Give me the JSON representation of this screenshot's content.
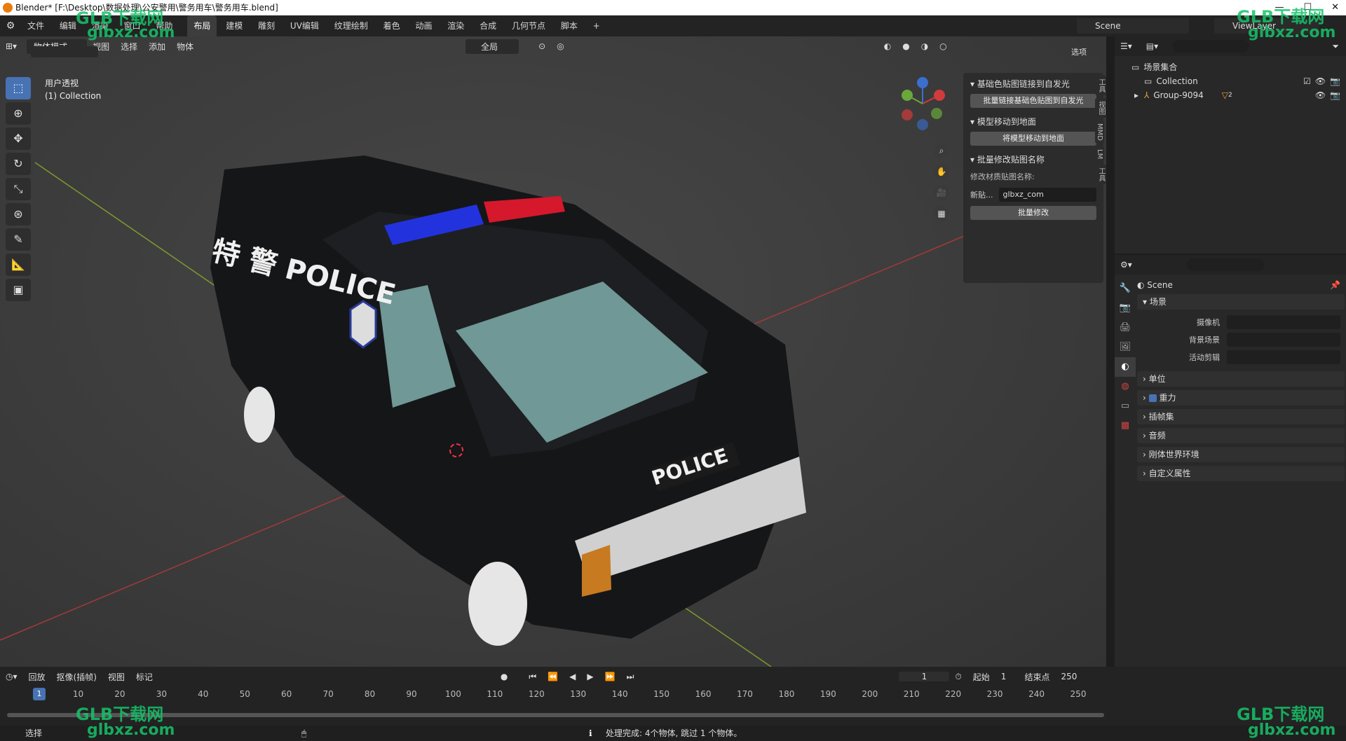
{
  "title": "Blender* [F:\\Desktop\\数据处理\\公安警用\\警务用车\\警务用车.blend]",
  "menu": [
    "文件",
    "编辑",
    "渲染",
    "窗口",
    "帮助"
  ],
  "workspaces": [
    "布局",
    "建模",
    "雕刻",
    "UV编辑",
    "纹理绘制",
    "着色",
    "动画",
    "渲染",
    "合成",
    "几何节点",
    "脚本"
  ],
  "active_workspace": "布局",
  "scene_name": "Scene",
  "view_layer": "ViewLayer",
  "viewport": {
    "mode": "物体模式",
    "menus": [
      "视图",
      "选择",
      "添加",
      "物体"
    ],
    "orientation": "全局",
    "options_label": "选项",
    "view_name": "用户透视",
    "collection_label": "(1) Collection",
    "tools": [
      "select-box-icon",
      "cursor-icon",
      "move-icon",
      "rotate-icon",
      "scale-icon",
      "transform-icon",
      "annotate-icon",
      "measure-icon",
      "add-cube-icon"
    ]
  },
  "npanel": {
    "section1": "基础色贴图链接到自发光",
    "button1": "批量链接基础色贴图到自发光",
    "section2": "模型移动到地面",
    "button2": "将模型移动到地面",
    "section3": "批量修改贴图名称",
    "rename_label": "修改材质贴图名称:",
    "new_label": "新贴...",
    "new_value": "glbxz_com",
    "button3": "批量修改",
    "tabs": [
      "工具",
      "视图",
      "MMD",
      "LM",
      "工具"
    ]
  },
  "scene_text": {
    "side_text": "特 警 POLICE",
    "hood_text": "POLICE"
  },
  "outliner": {
    "root": "场景集合",
    "items": [
      {
        "label": "Collection"
      },
      {
        "label": "Group-9094",
        "badge": "2"
      }
    ]
  },
  "properties": {
    "header": "Scene",
    "section_scene": "场景",
    "rows": [
      {
        "label": "摄像机"
      },
      {
        "label": "背景场景"
      },
      {
        "label": "活动剪辑"
      }
    ],
    "collapsed": [
      "单位",
      "重力",
      "插帧集",
      "音频",
      "刚体世界环境",
      "自定义属性"
    ]
  },
  "timeline": {
    "menus": [
      "回放",
      "抠像(插帧)",
      "视图",
      "标记"
    ],
    "current_frame": "1",
    "start_label": "起始",
    "start": "1",
    "end_label": "结束点",
    "end": "250",
    "ticks": [
      "1",
      "10",
      "20",
      "30",
      "40",
      "50",
      "60",
      "70",
      "80",
      "90",
      "100",
      "110",
      "120",
      "130",
      "140",
      "150",
      "160",
      "170",
      "180",
      "190",
      "200",
      "210",
      "220",
      "230",
      "240",
      "250"
    ]
  },
  "status": {
    "left": "选择",
    "message": "处理完成: 4个物体, 跳过 1 个物体。"
  },
  "watermark": {
    "brand": "GLB下载网",
    "site": "glbxz.com"
  }
}
